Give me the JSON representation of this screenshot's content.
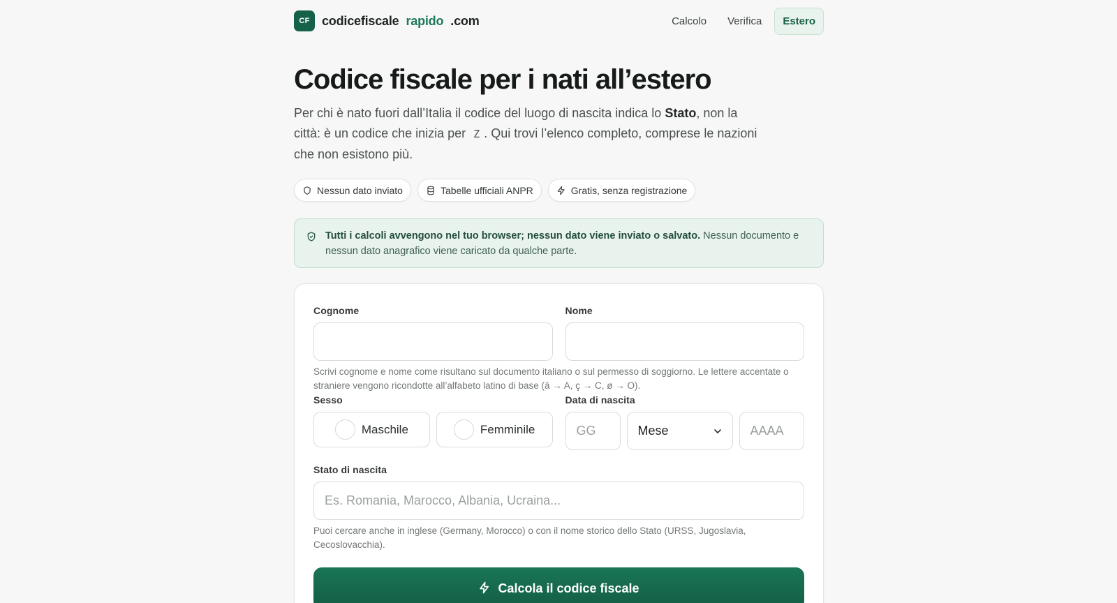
{
  "header": {
    "logo_text": "CF",
    "brand_1": "codicefiscale",
    "brand_2": "rapido",
    "brand_3": ".com",
    "nav": [
      "Calcolo",
      "Verifica",
      "Estero"
    ]
  },
  "hero": {
    "title": "Codice fiscale per i nati all’estero",
    "lede_1": "Per chi è nato fuori dall’Italia il codice del luogo di nascita indica lo ",
    "lede_bold": "Stato",
    "lede_2": ", non la città: è un codice che inizia per",
    "lede_code": "Z",
    "lede_3": ". Qui trovi l’elenco completo, comprese le nazioni che non esistono più."
  },
  "chips": [
    "Nessun dato inviato",
    "Tabelle ufficiali ANPR",
    "Gratis, senza registrazione"
  ],
  "notice": {
    "bold": "Tutti i calcoli avvengono nel tuo browser; nessun dato viene inviato o salvato.",
    "rest": " Nessun documento e nessun dato anagrafico viene caricato da qualche parte."
  },
  "form": {
    "cognome_label": "Cognome",
    "nome_label": "Nome",
    "name_hint": "Scrivi cognome e nome come risultano sul documento italiano o sul permesso di soggiorno. Le lettere accentate o straniere vengono ricondotte all’alfabeto latino di base (ä → A, ç → C, ø → O).",
    "sesso_label": "Sesso",
    "maschile": "Maschile",
    "femminile": "Femminile",
    "data_label": "Data di nascita",
    "gg_placeholder": "GG",
    "mese_value": "Mese",
    "aaaa_placeholder": "AAAA",
    "stato_label": "Stato di nascita",
    "stato_placeholder": "Es. Romania, Marocco, Albania, Ucraina...",
    "stato_hint": "Puoi cercare anche in inglese (Germany, Morocco) o con il nome storico dello Stato (URSS, Jugoslavia, Cecoslovacchia).",
    "submit": "Calcola il codice fiscale"
  },
  "colors": {
    "brand": "#16614a",
    "accent": "#1c7a59",
    "notice_bg": "#e8f3ed"
  }
}
